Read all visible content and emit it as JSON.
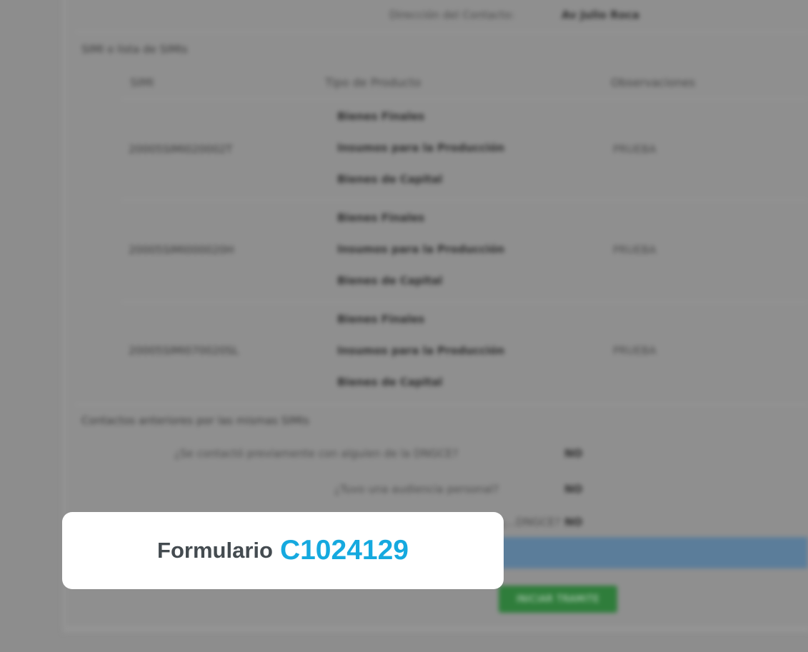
{
  "contact_address": {
    "label": "Dirección del Contacto:",
    "value": "Av Julio Roca"
  },
  "ncm_section": {
    "title": "SIMI o lista de SIMIs",
    "headers": [
      "SIMI",
      "Tipo de Producto",
      "Observaciones"
    ],
    "rows": [
      {
        "simi": "20005SIMI020002T",
        "products": [
          "Bienes Finales",
          "Insumos para la Producción",
          "Bienes de Capital"
        ],
        "observation": "PRUEBA"
      },
      {
        "simi": "20005SIMI000020H",
        "products": [
          "Bienes Finales",
          "Insumos para la Producción",
          "Bienes de Capital"
        ],
        "observation": "PRUEBA"
      },
      {
        "simi": "20005SIMI070020SL",
        "products": [
          "Bienes Finales",
          "Insumos para la Producción",
          "Bienes de Capital"
        ],
        "observation": "PRUEBA"
      }
    ]
  },
  "previous_contacts": {
    "title": "Contactos anteriores por las mismas SIMIs",
    "questions": [
      {
        "q": "¿Se contactó previamente con alguien de la DNGCE?",
        "a": "NO"
      },
      {
        "q": "¿Tuvo una audiencia personal?",
        "a": "NO"
      },
      {
        "q": "¿...DNGCE?",
        "a": "NO"
      }
    ]
  },
  "submit_button": "INICIAR TRAMITE",
  "badge": {
    "label": "Formulario",
    "code": "C1024129"
  }
}
